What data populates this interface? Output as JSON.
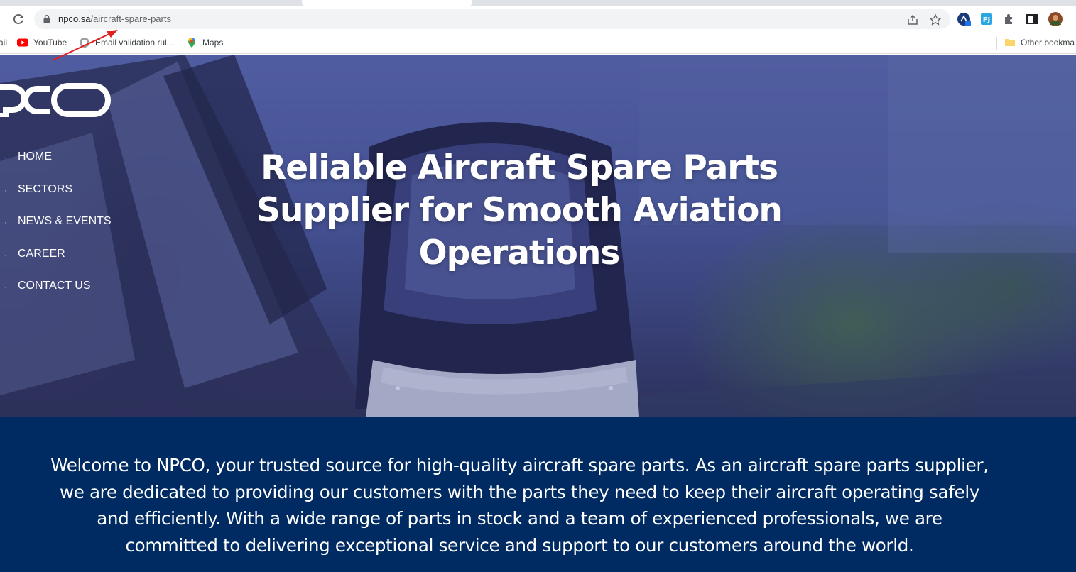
{
  "browser": {
    "url_domain": "npco.sa",
    "url_path": "/aircraft-spare-parts",
    "bookmarks": [
      {
        "label": "ail",
        "icon": "mail-icon"
      },
      {
        "label": "YouTube",
        "icon": "youtube-icon"
      },
      {
        "label": "Email validation rul...",
        "icon": "site-icon"
      },
      {
        "label": "Maps",
        "icon": "maps-icon"
      }
    ],
    "other_bookmarks": "Other bookma"
  },
  "site": {
    "logo_text": "PCO",
    "nav": [
      {
        "label": "HOME"
      },
      {
        "label": "SECTORS"
      },
      {
        "label": "NEWS & EVENTS"
      },
      {
        "label": "CAREER"
      },
      {
        "label": "CONTACT US"
      }
    ],
    "hero": {
      "title_line1": "Reliable Aircraft Spare Parts",
      "title_line2": "Supplier for Smooth Aviation",
      "title_line3": "Operations"
    },
    "intro_text": "Welcome to NPCO, your trusted source for high-quality aircraft spare parts. As an aircraft spare parts supplier, we are dedicated to providing our customers with the parts they need to keep their aircraft operating safely and efficiently. With a wide range of parts in stock and a team of experienced professionals, we are committed to delivering exceptional service and support to our customers around the world."
  },
  "colors": {
    "intro_background": "#002a62",
    "annotation_arrow": "#e0201f"
  }
}
